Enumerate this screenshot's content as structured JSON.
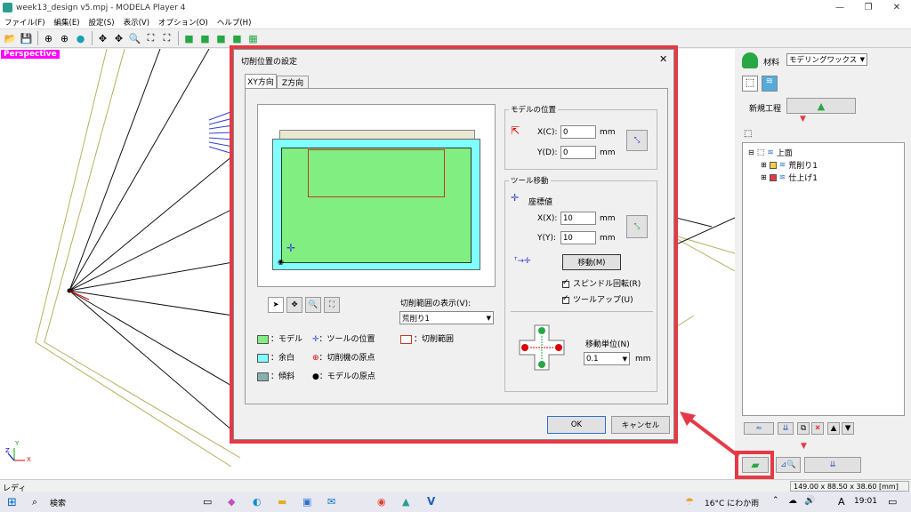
{
  "window": {
    "title": "week13_design v5.mpj - MODELA Player 4",
    "min": "—",
    "max": "❐",
    "close": "✕"
  },
  "menu": [
    "ファイル(F)",
    "編集(E)",
    "設定(S)",
    "表示(V)",
    "オプション(O)",
    "ヘルプ(H)"
  ],
  "viewport": {
    "label": "Perspective",
    "axis_x": "X",
    "axis_y": "Y",
    "axis_z": "Z"
  },
  "right_panel": {
    "material_label": "材料",
    "material_value": "モデリングワックス",
    "new_process": "新規工程",
    "tree": {
      "root": "上面",
      "items": [
        "荒削り1",
        "仕上げ1"
      ]
    }
  },
  "dialog": {
    "title": "切削位置の設定",
    "close": "✕",
    "tabs": [
      "XY方向",
      "Z方向"
    ],
    "model_pos": {
      "group": "モデルの位置",
      "x_label": "X(C):",
      "x_value": "0",
      "y_label": "Y(D):",
      "y_value": "0",
      "unit": "mm"
    },
    "tool_move": {
      "group": "ツール移動",
      "coord_label": "座標値",
      "x_label": "X(X):",
      "x_value": "10",
      "y_label": "Y(Y):",
      "y_value": "10",
      "unit": "mm",
      "move_btn": "移動(M)",
      "spindle": "スピンドル回転(R)",
      "toolup": "ツールアップ(U)",
      "step_label": "移動単位(N)",
      "step_value": "0.1",
      "step_unit": "mm"
    },
    "range_label": "切削範囲の表示(V):",
    "range_value": "荒削り1",
    "legend": {
      "model": "：モデル",
      "margin": "：余白",
      "slope": "：傾斜",
      "tool_pos": "：ツールの位置",
      "machine_origin": "：切削機の原点",
      "model_origin": "：モデルの原点",
      "cut_range": "：切削範囲"
    },
    "ok": "OK",
    "cancel": "キャンセル"
  },
  "status": {
    "left": "レディ",
    "dims": "149.00 x 88.50 x 38.60 [mm]"
  },
  "taskbar": {
    "search": "検索",
    "weather": "16°C にわか雨",
    "ime": "A",
    "time": "19:01"
  },
  "colors": {
    "model": "#80ee80",
    "margin": "#80ffff",
    "slope": "#86b0b0",
    "highlight": "#e63946"
  }
}
